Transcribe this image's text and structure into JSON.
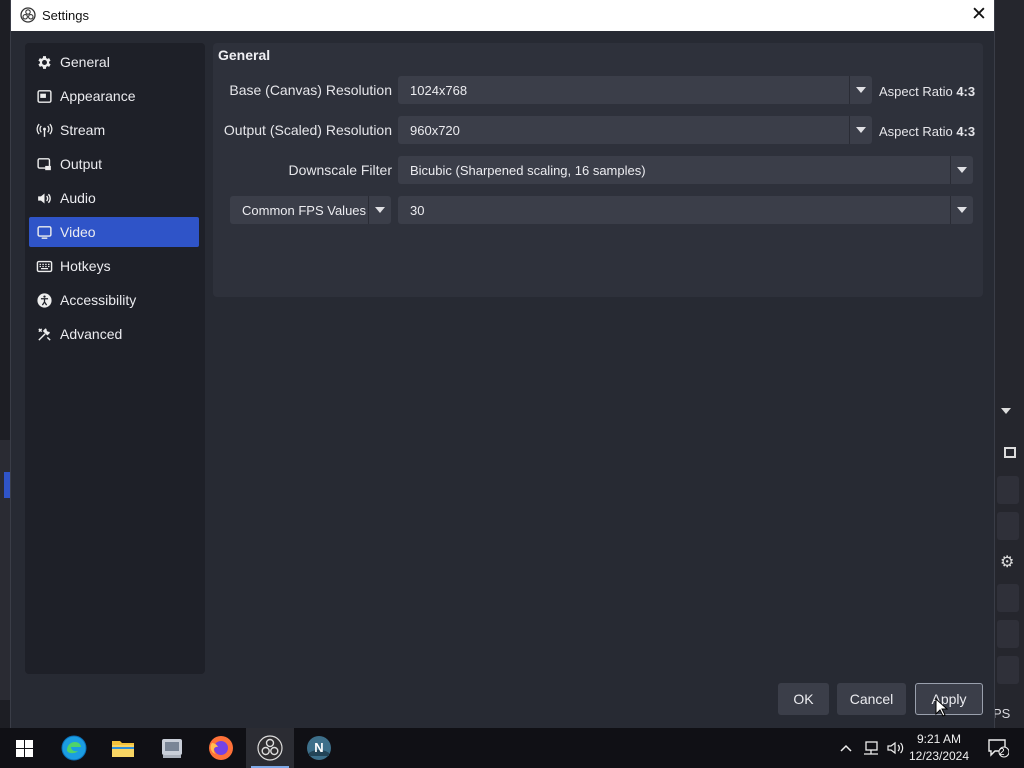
{
  "window": {
    "title": "Settings"
  },
  "sidebar": {
    "items": [
      {
        "label": "General",
        "icon": "gear-icon"
      },
      {
        "label": "Appearance",
        "icon": "appearance-icon"
      },
      {
        "label": "Stream",
        "icon": "broadcast-icon"
      },
      {
        "label": "Output",
        "icon": "output-icon"
      },
      {
        "label": "Audio",
        "icon": "speaker-icon"
      },
      {
        "label": "Video",
        "icon": "monitor-icon"
      },
      {
        "label": "Hotkeys",
        "icon": "keyboard-icon"
      },
      {
        "label": "Accessibility",
        "icon": "accessibility-icon"
      },
      {
        "label": "Advanced",
        "icon": "tools-icon"
      }
    ],
    "active": "Video"
  },
  "panel": {
    "title": "General",
    "base_resolution": {
      "label": "Base (Canvas) Resolution",
      "value": "1024x768",
      "aspect_prefix": "Aspect Ratio",
      "aspect_value": "4:3"
    },
    "output_resolution": {
      "label": "Output (Scaled) Resolution",
      "value": "960x720",
      "aspect_prefix": "Aspect Ratio",
      "aspect_value": "4:3"
    },
    "downscale_filter": {
      "label": "Downscale Filter",
      "value": "Bicubic (Sharpened scaling, 16 samples)"
    },
    "fps": {
      "type_value": "Common FPS Values",
      "value": "30"
    }
  },
  "buttons": {
    "ok": "OK",
    "cancel": "Cancel",
    "apply": "Apply"
  },
  "background": {
    "fps_fragment": "PS"
  },
  "taskbar": {
    "apps": [
      "start-icon",
      "edge-icon",
      "file-explorer-icon",
      "app-icon",
      "firefox-icon",
      "obs-icon",
      "app-n-icon"
    ],
    "time": "9:21 AM",
    "date": "12/23/2024",
    "notification_count": "2"
  },
  "colors": {
    "accent": "#2f54c8",
    "dialog_bg": "#272a33",
    "panel_bg": "#2e313b",
    "combo_bg": "#3b3e49"
  }
}
